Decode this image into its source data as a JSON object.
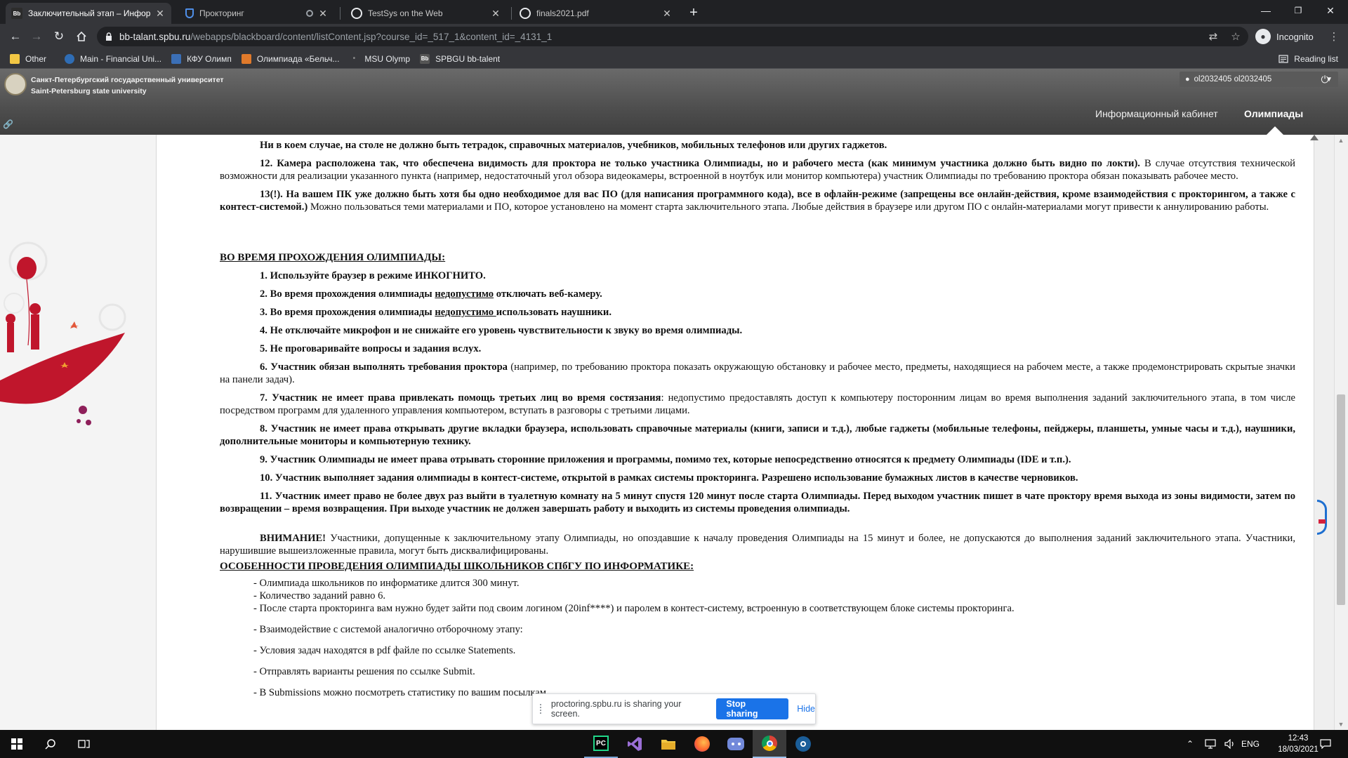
{
  "browser": {
    "tabs": [
      {
        "label": "Заключительный этап – Инфор",
        "favicon": "Bb",
        "active": true
      },
      {
        "label": "Прокторинг",
        "favicon": "shield",
        "active": false
      },
      {
        "label": "TestSys on the Web",
        "favicon": "globe",
        "active": false
      },
      {
        "label": "finals2021.pdf",
        "favicon": "globe",
        "active": false
      }
    ],
    "url_host": "bb-talant.spbu.ru",
    "url_path": "/webapps/blackboard/content/listContent.jsp?course_id=_517_1&content_id=_4131_1",
    "profile_label": "Incognito",
    "bookmarks": [
      {
        "label": "Other",
        "icon": "folder-icon",
        "color": "#f2c744"
      },
      {
        "label": "Main - Financial Uni...",
        "icon": "fa-icon",
        "color": "#2f6db5"
      },
      {
        "label": "КФУ Олимп",
        "icon": "kfu-icon",
        "color": "#3b6fb6"
      },
      {
        "label": "Олимпиада «Бельч...",
        "icon": "squirrel-icon",
        "color": "#e07a2b"
      },
      {
        "label": "MSU Olymp",
        "icon": "msu-icon",
        "color": "#888888"
      },
      {
        "label": "SPBGU bb-talent",
        "icon": "bb-icon",
        "color": "#555555"
      }
    ],
    "reading_list": "Reading list"
  },
  "site": {
    "uni_name_ru": "Санкт-Петербургский государственный университет",
    "uni_name_en": "Saint-Petersburg state university",
    "user": "ol2032405 ol2032405",
    "nav": [
      {
        "label": "Информационный кабинет",
        "active": false
      },
      {
        "label": "Олимпиады",
        "active": true
      }
    ]
  },
  "doc": {
    "p_top": "Ни в коем случае, на столе не должно быть тетрадок, справочных материалов, учебников, мобильных телефонов или других гаджетов.",
    "p12_b": "12. Камера расположена так, что обеспечена видимость для проктора не только участника Олимпиады, но и рабочего места (как минимум участника должно быть видно по локти).",
    "p12_n": " В случае отсутствия технической возможности для реализации указанного пункта (например, недостаточный угол обзора видеокамеры, встроенной в ноутбук или монитор компьютера) участник Олимпиады по требованию проктора обязан показывать рабочее место.",
    "p13_b": "13(!). На вашем ПК уже должно быть хотя бы одно необходимое для вас ПО (для написания программного кода), все в офлайн-режиме (запрещены все онлайн-действия, кроме взаимодействия с прокторингом, а также с контест-системой.)",
    "p13_n": " Можно пользоваться теми материалами и ПО, которое установлено на момент старта заключительного этапа. Любые действия в браузере или другом ПО с онлайн-материалами могут привести к аннулированию работы.",
    "h_during": "ВО ВРЕМЯ ПРОХОЖДЕНИЯ ОЛИМПИАДЫ:",
    "r1": "1. Используйте браузер в режиме ИНКОГНИТО.",
    "r2_a": "2. Во время прохождения олимпиады ",
    "r2_u": "недопустимо",
    "r2_b": " отключать веб-камеру.",
    "r3_a": "3. Во время прохождения олимпиады ",
    "r3_u": "недопустимо ",
    "r3_b": "использовать наушники.",
    "r4": "4. Не отключайте микрофон и не снижайте его уровень чувствительности к звуку во время олимпиады.",
    "r5": "5. Не проговаривайте вопросы и задания вслух.",
    "r6_b": "6. Участник обязан выполнять требования проктора",
    "r6_n": " (например, по требованию проктора показать окружающую обстановку и рабочее место, предметы, находящиеся на рабочем месте, а также продемонстрировать скрытые значки на панели задач).",
    "r7_b": "7. Участник не имеет права привлекать помощь третьих лиц во время состязания",
    "r7_n": ": недопустимо предоставлять доступ к компьютеру посторонним лицам во время выполнения заданий заключительного этапа, в том числе посредством программ для удаленного управления компьютером, вступать в разговоры с третьими лицами.",
    "r8": "8. Участник не имеет права открывать другие вкладки браузера, использовать справочные материалы (книги, записи и т.д.), любые гаджеты (мобильные телефоны, пейджеры, планшеты, умные часы и т.д.), наушники, дополнительные мониторы и компьютерную технику.",
    "r9": "9. Участник Олимпиады не имеет права отрывать сторонние приложения и программы, помимо тех, которые непосредственно относятся к предмету Олимпиады (IDE и т.п.).",
    "r10": "10. Участник выполняет задания олимпиады в контест-системе, открытой в рамках системы прокторинга. Разрешено использование бумажных листов в качестве черновиков.",
    "r11": "11. Участник имеет право не более двух раз выйти в туалетную комнату на 5 минут спустя 120 минут после старта Олимпиады. Перед выходом участник пишет в чате проктору время выхода из зоны видимости, затем по возвращении – время возвращения. При выходе участник не должен завершать работу и выходить из системы проведения олимпиады.",
    "att_b": "ВНИМАНИЕ!",
    "att_n": " Участники, допущенные к заключительному этапу Олимпиады, но опоздавшие к началу проведения Олимпиады на 15 минут и более, не допускаются до выполнения заданий заключительного этапа. Участники, нарушившие вышеизложенные правила, могут быть дисквалифицированы.",
    "h_features": "ОСОБЕННОСТИ ПРОВЕДЕНИЯ ОЛИМПИАДЫ ШКОЛЬНИКОВ СПбГУ ПО ИНФОРМАТИКЕ:",
    "f1": "- Олимпиада школьников по информатике длится 300 минут.",
    "f2": "- Количество заданий равно 6.",
    "f3": "- После старта прокторинга вам нужно будет зайти под своим логином (20inf****) и паролем в контест-систему, встроенную в соответствующем блоке системы прокторинга.",
    "f4": "- Взаимодействие с системой аналогично отборочному этапу:",
    "f5": "- Условия задач находятся в pdf файле по ссылке Statements.",
    "f6": "- Отправлять варианты решения по ссылке Submit.",
    "f7": "- В Submissions можно посмотреть статистику по вашим посылкам."
  },
  "sharing": {
    "text": "proctoring.spbu.ru is sharing your screen.",
    "stop": "Stop sharing",
    "hide": "Hide"
  },
  "taskbar": {
    "apps": [
      "pycharm-icon",
      "visual-studio-icon",
      "file-explorer-icon",
      "firefox-icon",
      "discord-icon",
      "chrome-icon",
      "steam-icon"
    ],
    "lang": "ENG",
    "time": "12:43",
    "date": "18/03/2021"
  }
}
